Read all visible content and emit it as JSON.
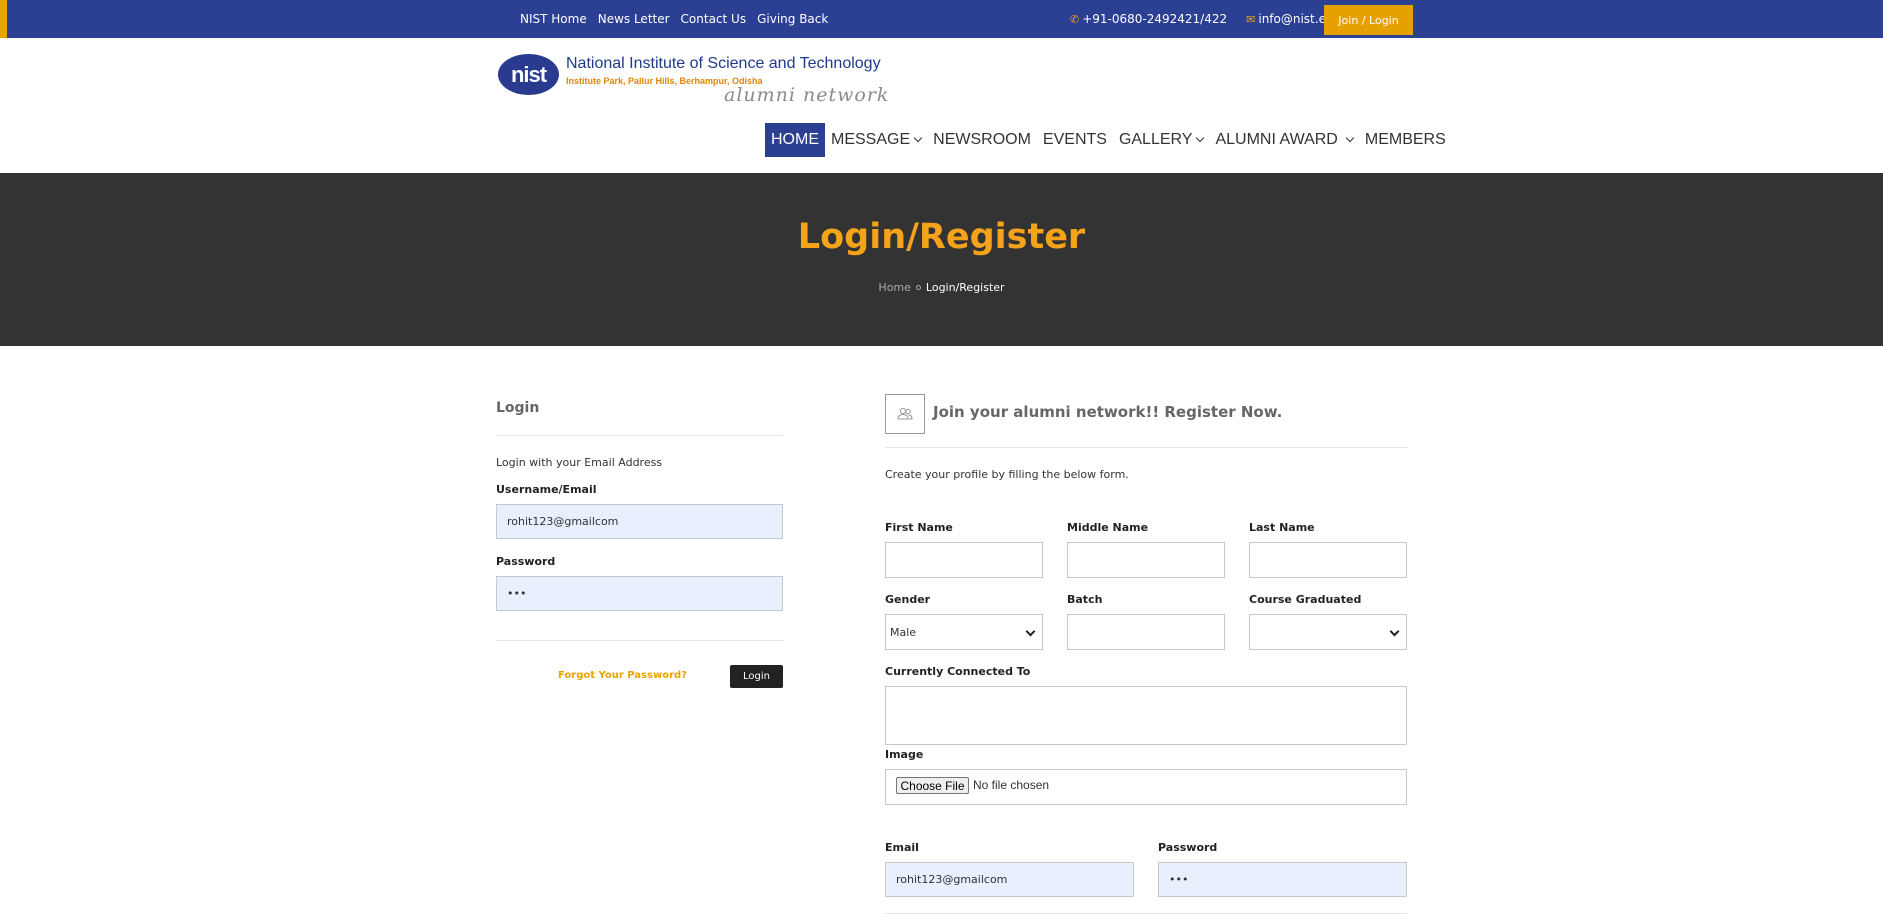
{
  "topbar": {
    "links": [
      "NIST Home",
      "News Letter",
      "Contact Us",
      "Giving Back"
    ],
    "phone": "+91-0680-2492421/422",
    "email": "info@nist.edu",
    "join_label": "Join / Login",
    "accent_color": "#e6a000",
    "bar_color": "#2b3f93"
  },
  "logo": {
    "badge": "nist",
    "title": "National Institute of Science and Technology",
    "subtitle": "Institute Park, Pallur Hills, Berhampur, Odisha",
    "tagline": "alumni network"
  },
  "nav": {
    "items": [
      {
        "label": "HOME",
        "active": true
      },
      {
        "label": "MESSAGE",
        "dropdown": true
      },
      {
        "label": "NEWSROOM"
      },
      {
        "label": "EVENTS"
      },
      {
        "label": "GALLERY",
        "dropdown": true
      },
      {
        "label": "ALUMNI AWARD",
        "dropdown": true
      },
      {
        "label": "MEMBERS"
      }
    ]
  },
  "banner": {
    "title": "Login/Register",
    "breadcrumb_home": "Home",
    "breadcrumb_current": "Login/Register"
  },
  "login": {
    "heading": "Login",
    "intro": "Login with your Email Address",
    "username_label": "Username/Email",
    "username_value": "rohit123@gmailcom",
    "password_label": "Password",
    "password_value": "•••",
    "forgot_label": "Forgot Your Password?",
    "submit_label": "Login"
  },
  "register": {
    "icon": "users-icon",
    "heading": "Join your alumni network!! Register Now.",
    "intro": "Create your profile by filling the below form.",
    "first_name_label": "First Name",
    "middle_name_label": "Middle Name",
    "last_name_label": "Last Name",
    "gender_label": "Gender",
    "gender_value": "Male",
    "batch_label": "Batch",
    "course_label": "Course Graduated",
    "course_value": "",
    "connected_label": "Currently Connected To",
    "image_label": "Image",
    "file_button": "Choose File",
    "file_status": "No file chosen",
    "email_label": "Email",
    "email_value": "rohit123@gmailcom",
    "password_label": "Password",
    "password_value": "•••"
  }
}
